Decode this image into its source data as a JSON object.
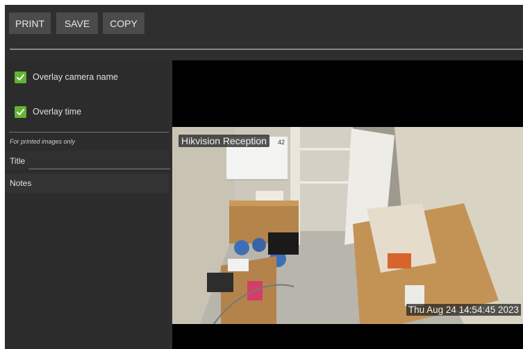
{
  "toolbar": {
    "print_label": "PRINT",
    "save_label": "SAVE",
    "copy_label": "COPY"
  },
  "options": {
    "overlay_camera_name": {
      "label": "Overlay camera name",
      "checked": true
    },
    "overlay_time": {
      "label": "Overlay time",
      "checked": true
    }
  },
  "print_fields": {
    "hint": "For printed images only",
    "title_label": "Title",
    "title_value": "",
    "notes_label": "Notes"
  },
  "camera": {
    "name": "Hikvision Reception",
    "timestamp": "Thu Aug 24 14:54:45 2023"
  },
  "colors": {
    "checkbox": "#62b332",
    "toolbar_button": "#4b4b4b",
    "panel_bg": "#2c2c2c"
  }
}
